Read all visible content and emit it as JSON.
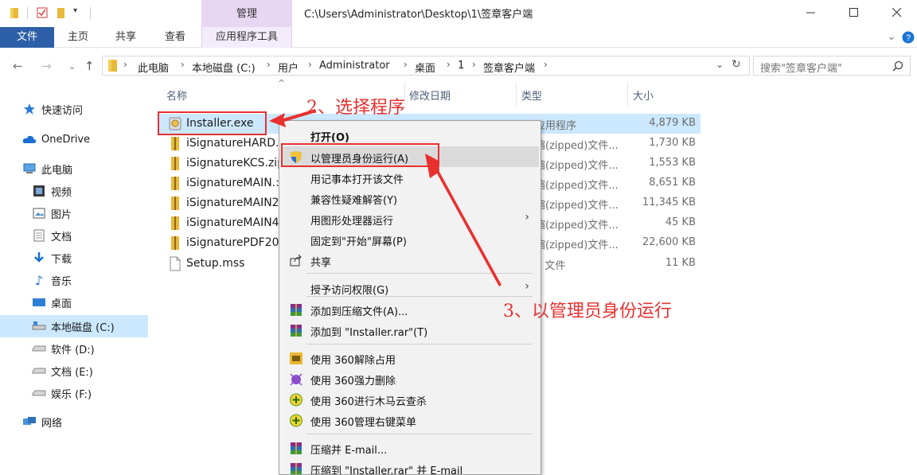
{
  "window": {
    "path_title": "C:\\Users\\Administrator\\Desktop\\1\\签章客户端",
    "manage_tab": "管理"
  },
  "ribbon": {
    "tabs": [
      "文件",
      "主页",
      "共享",
      "查看",
      "应用程序工具"
    ]
  },
  "address": {
    "crumbs": [
      "此电脑",
      "本地磁盘 (C:)",
      "用户",
      "Administrator",
      "桌面",
      "1",
      "签章客户端"
    ],
    "search_placeholder": "搜索\"签章客户端\""
  },
  "nav": {
    "items": [
      {
        "label": "快速访问",
        "icon": "star-icon"
      },
      {
        "label": "OneDrive",
        "icon": "cloud-icon"
      },
      {
        "label": "此电脑",
        "icon": "computer-icon"
      },
      {
        "label": "视频",
        "icon": "video-icon"
      },
      {
        "label": "图片",
        "icon": "picture-icon"
      },
      {
        "label": "文档",
        "icon": "document-icon"
      },
      {
        "label": "下载",
        "icon": "download-icon"
      },
      {
        "label": "音乐",
        "icon": "music-icon"
      },
      {
        "label": "桌面",
        "icon": "desktop-icon"
      },
      {
        "label": "本地磁盘 (C:)",
        "icon": "drive-c-icon"
      },
      {
        "label": "软件 (D:)",
        "icon": "drive-icon"
      },
      {
        "label": "文档 (E:)",
        "icon": "drive-icon"
      },
      {
        "label": "娱乐 (F:)",
        "icon": "drive-icon"
      },
      {
        "label": "网络",
        "icon": "network-icon"
      }
    ]
  },
  "filelist": {
    "headers": {
      "name": "名称",
      "date": "修改日期",
      "type": "类型",
      "size": "大小"
    },
    "rows": [
      {
        "name": "Installer.exe",
        "type": "应用程序",
        "size": "4,879 KB",
        "icon": "installer-icon",
        "selected": true
      },
      {
        "name": "iSignatureHARD.",
        "type": "缩(zipped)文件...",
        "size": "1,730 KB",
        "icon": "zip-icon",
        "selected": false
      },
      {
        "name": "iSignatureKCS.zip",
        "type": "缩(zipped)文件...",
        "size": "1,553 KB",
        "icon": "zip-icon",
        "selected": false
      },
      {
        "name": "iSignatureMAIN.:",
        "type": "缩(zipped)文件...",
        "size": "8,651 KB",
        "icon": "zip-icon",
        "selected": false
      },
      {
        "name": "iSignatureMAIN2",
        "type": "缩(zipped)文件...",
        "size": "11,345 KB",
        "icon": "zip-icon",
        "selected": false
      },
      {
        "name": "iSignatureMAIN4",
        "type": "缩(zipped)文件...",
        "size": "45 KB",
        "icon": "zip-icon",
        "selected": false
      },
      {
        "name": "iSignaturePDF20",
        "type": "缩(zipped)文件...",
        "size": "22,600 KB",
        "icon": "zip-icon",
        "selected": false
      },
      {
        "name": "Setup.mss",
        "type": "S 文件",
        "size": "11 KB",
        "icon": "file-icon",
        "selected": false
      }
    ]
  },
  "context_menu": {
    "items": [
      {
        "label": "打开(O)",
        "bold": true
      },
      {
        "label": "以管理员身份运行(A)",
        "icon": "shield-icon",
        "highlight": true
      },
      {
        "label": "用记事本打开该文件"
      },
      {
        "label": "兼容性疑难解答(Y)"
      },
      {
        "label": "用图形处理器运行",
        "submenu": true
      },
      {
        "label": "固定到\"开始\"屏幕(P)"
      },
      {
        "label": "共享",
        "icon": "share-icon"
      },
      {
        "label": "授予访问权限(G)",
        "submenu": true
      },
      {
        "label": "添加到压缩文件(A)...",
        "icon": "winrar-icon"
      },
      {
        "label": "添加到 \"Installer.rar\"(T)",
        "icon": "winrar-icon"
      },
      {
        "label": "使用 360解除占用",
        "icon": "360-unlock-icon"
      },
      {
        "label": "使用 360强力删除",
        "icon": "360-delete-icon"
      },
      {
        "label": "使用 360进行木马云查杀",
        "icon": "360-scan-icon"
      },
      {
        "label": "使用 360管理右键菜单",
        "icon": "360-menu-icon"
      },
      {
        "label": "压缩并 E-mail...",
        "icon": "winrar-icon"
      },
      {
        "label": "压缩到 \"Installer.rar\" 并 E-mail",
        "icon": "winrar-icon"
      }
    ]
  },
  "annotations": {
    "step2": "2、选择程序",
    "step3": "3、以管理员身份运行"
  },
  "colors": {
    "annotation_red": "#e8312f",
    "selection_blue": "#cce8ff",
    "file_tab_blue": "#2c5fa8",
    "manage_tab_purple": "#e8d7f3"
  }
}
